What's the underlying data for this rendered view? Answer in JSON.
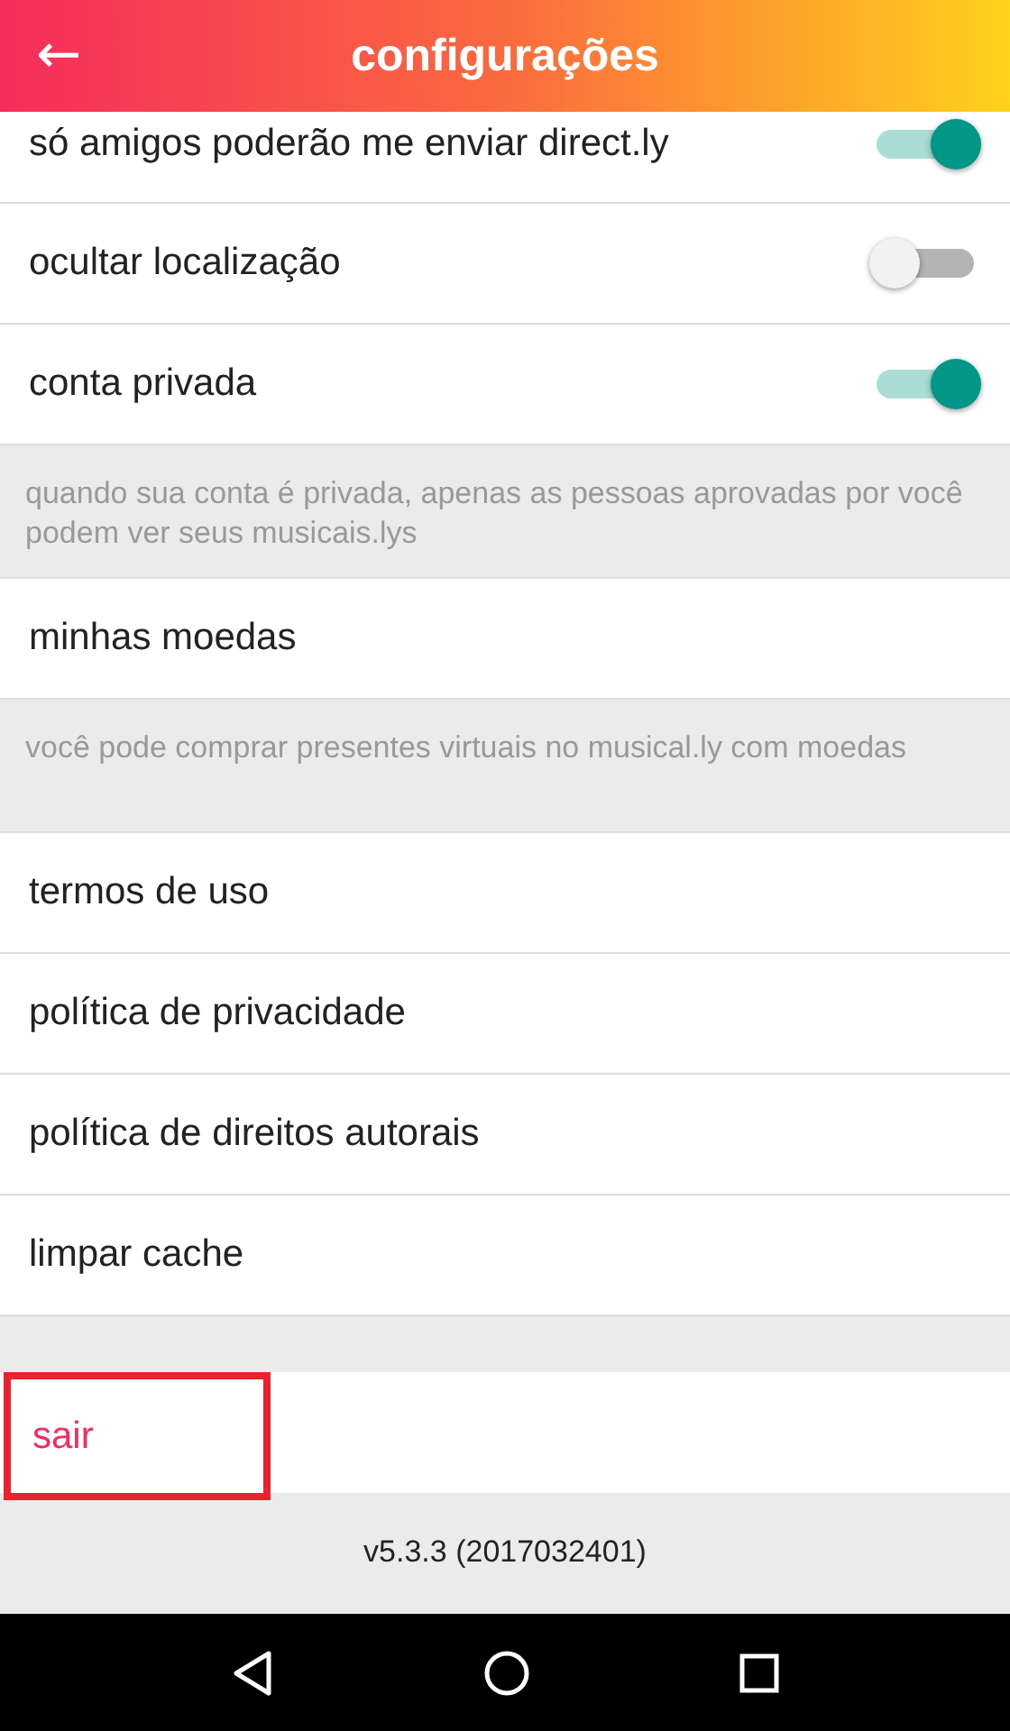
{
  "header": {
    "back": "←",
    "title": "configurações"
  },
  "items": [
    {
      "kind": "toggle",
      "label": "só amigos poderão me enviar direct.ly",
      "on": true,
      "cut": true
    },
    {
      "kind": "toggle",
      "label": "ocultar localização",
      "on": false
    },
    {
      "kind": "toggle",
      "label": "conta privada",
      "on": true
    },
    {
      "kind": "note",
      "label": "quando sua conta é privada, apenas as pessoas aprovadas por você podem ver seus musicais.lys"
    },
    {
      "kind": "link",
      "label": "minhas moedas"
    },
    {
      "kind": "note",
      "label": "você pode comprar presentes virtuais no musical.ly com moedas"
    },
    {
      "kind": "link",
      "label": "termos de uso"
    },
    {
      "kind": "link",
      "label": "política de privacidade"
    },
    {
      "kind": "link",
      "label": "política de direitos autorais"
    },
    {
      "kind": "link",
      "label": "limpar cache"
    },
    {
      "kind": "gap"
    },
    {
      "kind": "logout",
      "label": "sair",
      "highlighted": true
    }
  ],
  "version": "v5.3.3 (2017032401)"
}
